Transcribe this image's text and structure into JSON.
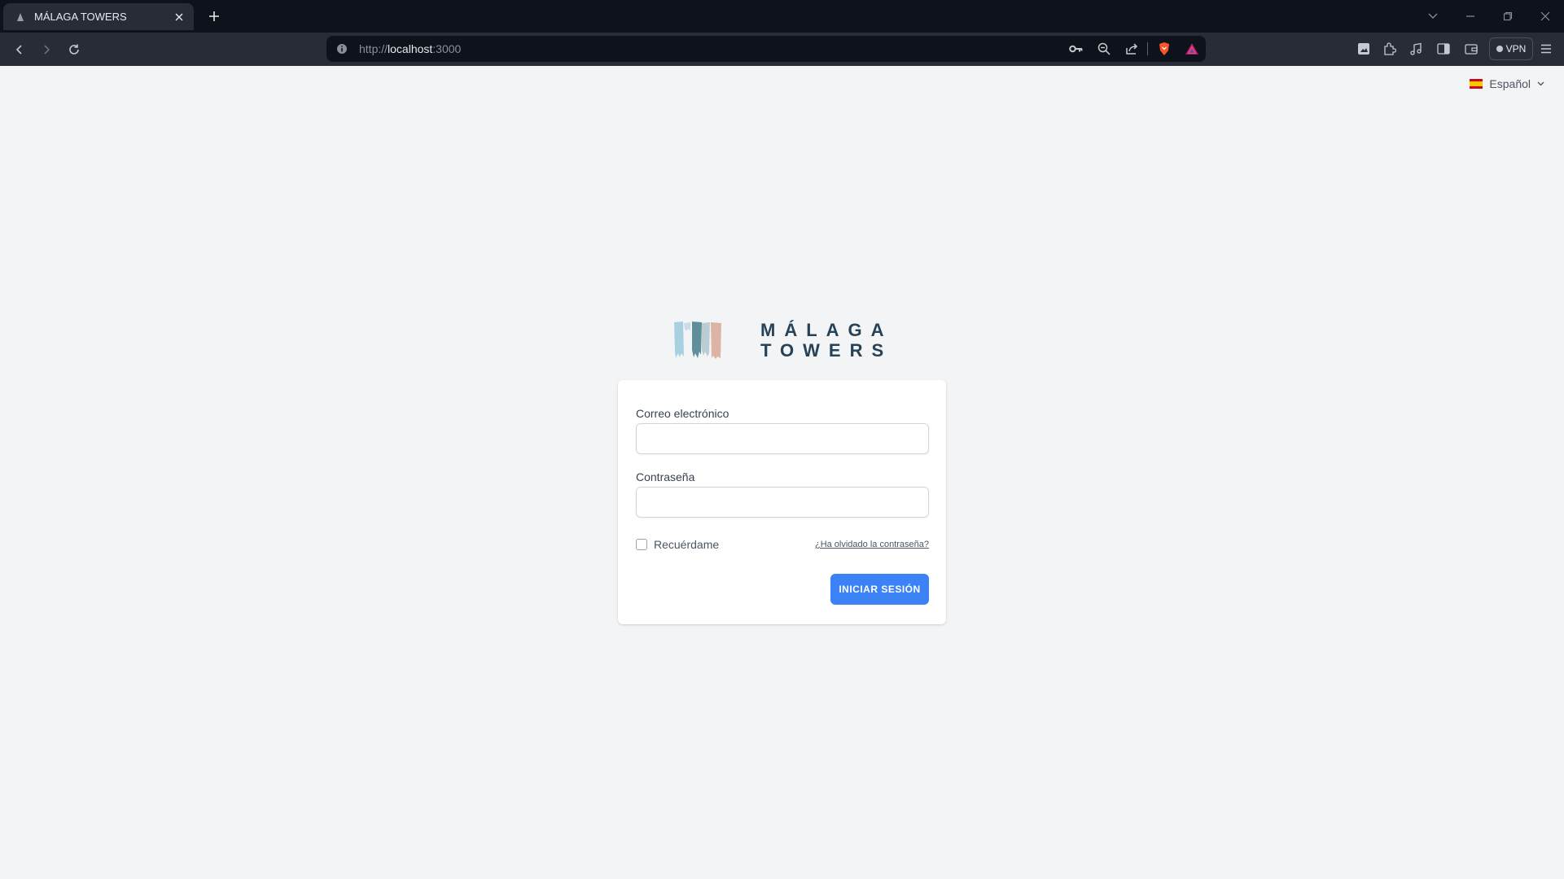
{
  "browser": {
    "tab_title": "MÁLAGA TOWERS",
    "url_scheme": "http://",
    "url_host": "localhost",
    "url_port": ":3000",
    "vpn_label": "VPN"
  },
  "page": {
    "language": "Español",
    "logo": {
      "line1": "MÁLAGA",
      "line2": "TOWERS"
    },
    "form": {
      "email_label": "Correo electrónico",
      "email_value": "",
      "password_label": "Contraseña",
      "password_value": "",
      "remember_label": "Recuérdame",
      "remember_checked": false,
      "forgot_link": "¿Ha olvidado la contraseña?",
      "submit_label": "INICIAR SESIÓN"
    }
  },
  "colors": {
    "accent": "#3b82f6",
    "logo_text": "#264257",
    "page_bg": "#f3f4f6"
  },
  "icons": [
    "brave-favicon",
    "close-icon",
    "plus-icon",
    "chevron-down-icon",
    "minimize-icon",
    "restore-icon",
    "close-window-icon",
    "back-icon",
    "forward-icon",
    "reload-icon",
    "info-icon",
    "key-icon",
    "zoom-out-icon",
    "share-icon",
    "brave-shields-icon",
    "brave-rewards-icon",
    "screenshot-icon",
    "extensions-icon",
    "media-icon",
    "sidebar-icon",
    "wallet-icon",
    "menu-icon",
    "spain-flag-icon"
  ]
}
